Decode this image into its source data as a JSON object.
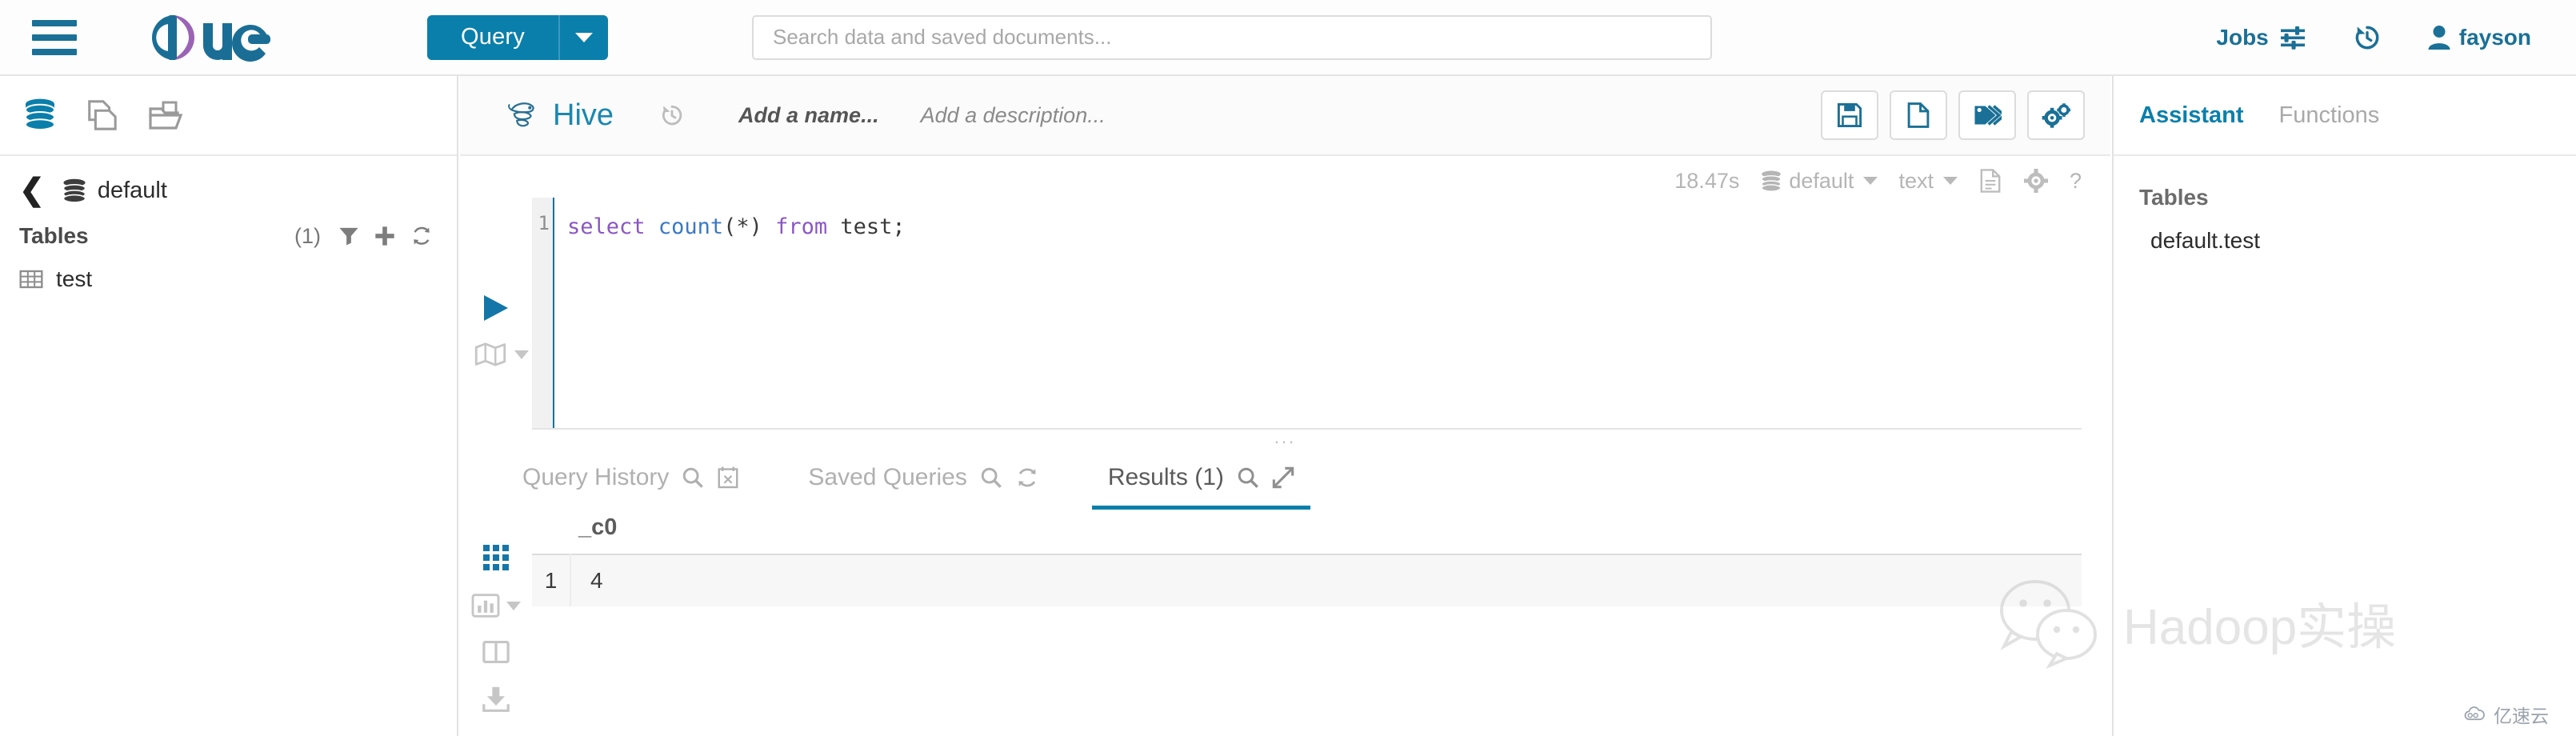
{
  "navbar": {
    "menu_icon": "hamburger-menu-icon",
    "logo_text": "hue",
    "query_button": {
      "label": "Query",
      "caret_icon": "chevron-down-icon"
    },
    "search": {
      "placeholder": "Search data and saved documents...",
      "value": "",
      "icon": "search-icon"
    },
    "jobs": {
      "label": "Jobs",
      "icon": "sliders-icon"
    },
    "history": {
      "icon": "history-clock-icon"
    },
    "user": {
      "label": "fayson",
      "icon": "user-icon"
    }
  },
  "sidebar": {
    "toolbar": {
      "sources_icon": "database-icon",
      "documents_icon": "documents-icon",
      "browse_icon": "folder-open-icon"
    },
    "breadcrumb": {
      "back_icon": "chevron-left-icon",
      "db_icon": "database-icon",
      "database": "default"
    },
    "tables_section": {
      "title": "Tables",
      "count": "(1)",
      "filter_icon": "filter-icon",
      "add_icon": "plus-icon",
      "refresh_icon": "refresh-icon"
    },
    "tables": [
      {
        "name": "test",
        "icon": "table-icon"
      }
    ]
  },
  "editor": {
    "engine": {
      "name": "Hive",
      "icon": "hive-bee-icon"
    },
    "history_icon": "history-clock-icon",
    "name_placeholder": "Add a name...",
    "description_placeholder": "Add a description...",
    "header_buttons": [
      {
        "name": "save",
        "icon": "floppy-save-icon"
      },
      {
        "name": "new-document",
        "icon": "file-new-icon"
      },
      {
        "name": "tags",
        "icon": "tags-icon"
      },
      {
        "name": "settings",
        "icon": "gears-icon"
      }
    ],
    "status": {
      "elapsed": "18.47s",
      "database": {
        "label": "default",
        "icon": "database-icon",
        "caret": "chevron-down-icon"
      },
      "format": {
        "label": "text",
        "caret": "chevron-down-icon"
      },
      "log_icon": "file-lines-icon",
      "settings_icon": "gear-icon",
      "help_label": "?"
    },
    "gutter": {
      "run_icon": "play-triangle-icon",
      "explain_icon": "map-icon",
      "explain_caret": "chevron-down-icon"
    },
    "code": {
      "line_number": "1",
      "tokens": [
        {
          "text": "select",
          "type": "keyword"
        },
        {
          "text": " ",
          "type": "plain"
        },
        {
          "text": "count",
          "type": "function"
        },
        {
          "text": "(*) ",
          "type": "plain"
        },
        {
          "text": "from",
          "type": "keyword"
        },
        {
          "text": " test;",
          "type": "plain"
        }
      ],
      "full_text": "select count(*) from test;"
    },
    "splitter_handle": "..."
  },
  "result_tabs": [
    {
      "label": "Query History",
      "active": false,
      "icons": [
        "search-icon",
        "calendar-x-icon"
      ]
    },
    {
      "label": "Saved Queries",
      "active": false,
      "icons": [
        "search-icon",
        "refresh-icon"
      ]
    },
    {
      "label": "Results (1)",
      "active": true,
      "icons": [
        "search-icon",
        "expand-arrows-icon"
      ]
    }
  ],
  "results": {
    "side_tools": [
      {
        "name": "grid-view",
        "icon": "grid-icon",
        "active": true
      },
      {
        "name": "chart-view",
        "icon": "bar-chart-icon",
        "active": false,
        "caret": "chevron-down-icon"
      },
      {
        "name": "columns-view",
        "icon": "columns-icon",
        "active": false
      },
      {
        "name": "download",
        "icon": "download-icon",
        "active": false
      }
    ],
    "columns": [
      "_c0"
    ],
    "rows": [
      {
        "index": "1",
        "values": [
          "4"
        ]
      }
    ]
  },
  "right_panel": {
    "tabs": [
      {
        "label": "Assistant",
        "active": true
      },
      {
        "label": "Functions",
        "active": false
      }
    ],
    "tables_heading": "Tables",
    "tables": [
      "default.test"
    ]
  },
  "watermarks": {
    "hadoop": {
      "text": "Hadoop实操",
      "icon": "wechat-icon"
    },
    "yisu": {
      "text": "亿速云",
      "icon": "cloud-icon"
    }
  },
  "colors": {
    "brand_teal": "#0b7fab",
    "logo_blue": "#1a6e96",
    "logo_purple": "#9b63b5",
    "accent_active": "#0b7fab"
  }
}
